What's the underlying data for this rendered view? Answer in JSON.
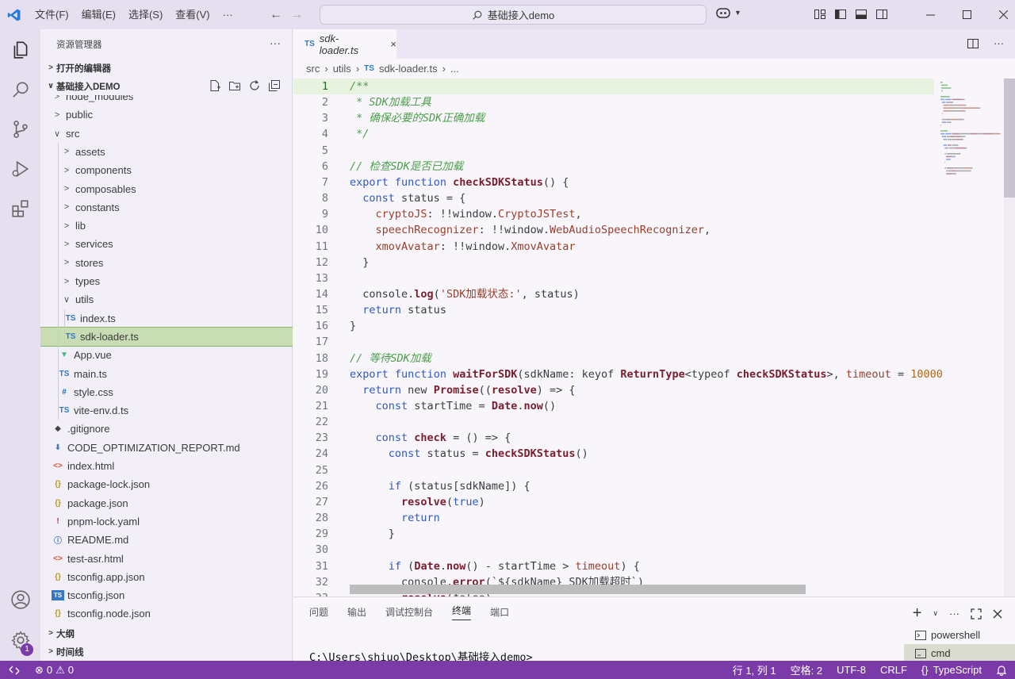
{
  "menu": [
    "文件(F)",
    "编辑(E)",
    "选择(S)",
    "查看(V)",
    "···"
  ],
  "search": "基础接入demo",
  "explorer": {
    "title": "资源管理器",
    "more": "···",
    "open_editors": "打开的编辑器",
    "project": "基础接入DEMO",
    "outline": "大纲",
    "timeline": "时间线"
  },
  "tree": [
    {
      "name": "node_modules",
      "type": "folder",
      "level": 1,
      "open": false
    },
    {
      "name": "public",
      "type": "folder",
      "level": 1,
      "open": false
    },
    {
      "name": "src",
      "type": "folder",
      "level": 1,
      "open": true
    },
    {
      "name": "assets",
      "type": "folder",
      "level": 2,
      "open": false
    },
    {
      "name": "components",
      "type": "folder",
      "level": 2,
      "open": false
    },
    {
      "name": "composables",
      "type": "folder",
      "level": 2,
      "open": false
    },
    {
      "name": "constants",
      "type": "folder",
      "level": 2,
      "open": false
    },
    {
      "name": "lib",
      "type": "folder",
      "level": 2,
      "open": false
    },
    {
      "name": "services",
      "type": "folder",
      "level": 2,
      "open": false
    },
    {
      "name": "stores",
      "type": "folder",
      "level": 2,
      "open": false
    },
    {
      "name": "types",
      "type": "folder",
      "level": 2,
      "open": false
    },
    {
      "name": "utils",
      "type": "folder",
      "level": 2,
      "open": true
    },
    {
      "name": "index.ts",
      "type": "ts",
      "level": 3
    },
    {
      "name": "sdk-loader.ts",
      "type": "ts",
      "level": 3,
      "selected": true
    },
    {
      "name": "App.vue",
      "type": "vue",
      "level": 2
    },
    {
      "name": "main.ts",
      "type": "ts",
      "level": 2
    },
    {
      "name": "style.css",
      "type": "css",
      "level": 2
    },
    {
      "name": "vite-env.d.ts",
      "type": "ts",
      "level": 2
    },
    {
      "name": ".gitignore",
      "type": "git",
      "level": 1
    },
    {
      "name": "CODE_OPTIMIZATION_REPORT.md",
      "type": "mdd",
      "level": 1
    },
    {
      "name": "index.html",
      "type": "html",
      "level": 1
    },
    {
      "name": "package-lock.json",
      "type": "json",
      "level": 1
    },
    {
      "name": "package.json",
      "type": "json",
      "level": 1
    },
    {
      "name": "pnpm-lock.yaml",
      "type": "yaml",
      "level": 1
    },
    {
      "name": "README.md",
      "type": "info",
      "level": 1
    },
    {
      "name": "test-asr.html",
      "type": "html",
      "level": 1
    },
    {
      "name": "tsconfig.app.json",
      "type": "json",
      "level": 1
    },
    {
      "name": "tsconfig.json",
      "type": "tsjson",
      "level": 1
    },
    {
      "name": "tsconfig.node.json",
      "type": "json",
      "level": 1
    }
  ],
  "tab": {
    "label": "sdk-loader.ts",
    "lang": "TS",
    "close": "×"
  },
  "breadcrumb": {
    "src": "src",
    "utils": "utils",
    "file": "sdk-loader.ts",
    "more": "..."
  },
  "code_lines": [
    [
      [
        "cmt",
        "/**"
      ]
    ],
    [
      [
        "cmt",
        " * SDK加载工具"
      ]
    ],
    [
      [
        "cmt",
        " * 确保必要的SDK正确加载"
      ]
    ],
    [
      [
        "cmt",
        " */"
      ]
    ],
    [],
    [
      [
        "cmt",
        "// 检查SDK是否已加载"
      ]
    ],
    [
      [
        "kw",
        "export"
      ],
      [
        "p",
        " "
      ],
      [
        "kw",
        "function"
      ],
      [
        "p",
        " "
      ],
      [
        "fn",
        "checkSDKStatus"
      ],
      [
        "p",
        "() {"
      ]
    ],
    [
      [
        "p",
        "  "
      ],
      [
        "kw",
        "const"
      ],
      [
        "p",
        " status = {"
      ]
    ],
    [
      [
        "p",
        "    "
      ],
      [
        "prop",
        "cryptoJS"
      ],
      [
        "p",
        ": !!window."
      ],
      [
        "prop",
        "CryptoJSTest"
      ],
      [
        "p",
        ","
      ]
    ],
    [
      [
        "p",
        "    "
      ],
      [
        "prop",
        "speechRecognizer"
      ],
      [
        "p",
        ": !!window."
      ],
      [
        "prop",
        "WebAudioSpeechRecognizer"
      ],
      [
        "p",
        ","
      ]
    ],
    [
      [
        "p",
        "    "
      ],
      [
        "prop",
        "xmovAvatar"
      ],
      [
        "p",
        ": !!window."
      ],
      [
        "prop",
        "XmovAvatar"
      ]
    ],
    [
      [
        "p",
        "  }"
      ]
    ],
    [],
    [
      [
        "p",
        "  console."
      ],
      [
        "fn",
        "log"
      ],
      [
        "p",
        "("
      ],
      [
        "str",
        "'SDK加载状态:'"
      ],
      [
        "p",
        ", status)"
      ]
    ],
    [
      [
        "p",
        "  "
      ],
      [
        "kw",
        "return"
      ],
      [
        "p",
        " status"
      ]
    ],
    [
      [
        "p",
        "}"
      ]
    ],
    [],
    [
      [
        "cmt",
        "// 等待SDK加载"
      ]
    ],
    [
      [
        "kw",
        "export"
      ],
      [
        "p",
        " "
      ],
      [
        "kw",
        "function"
      ],
      [
        "p",
        " "
      ],
      [
        "fn",
        "waitForSDK"
      ],
      [
        "p",
        "(sdkName: keyof "
      ],
      [
        "typ",
        "ReturnType"
      ],
      [
        "p",
        "<typeof "
      ],
      [
        "fn",
        "checkSDKStatus"
      ],
      [
        "p",
        ">, "
      ],
      [
        "prop",
        "timeout"
      ],
      [
        "p",
        " = "
      ],
      [
        "num",
        "10000"
      ]
    ],
    [
      [
        "p",
        "  "
      ],
      [
        "kw",
        "return"
      ],
      [
        "p",
        " new "
      ],
      [
        "typ",
        "Promise"
      ],
      [
        "p",
        "(("
      ],
      [
        "fn",
        "resolve"
      ],
      [
        "p",
        ") => {"
      ]
    ],
    [
      [
        "p",
        "    "
      ],
      [
        "kw",
        "const"
      ],
      [
        "p",
        " startTime = "
      ],
      [
        "typ",
        "Date"
      ],
      [
        "p",
        "."
      ],
      [
        "fn",
        "now"
      ],
      [
        "p",
        "()"
      ]
    ],
    [],
    [
      [
        "p",
        "    "
      ],
      [
        "kw",
        "const"
      ],
      [
        "p",
        " "
      ],
      [
        "fn",
        "check"
      ],
      [
        "p",
        " = () => {"
      ]
    ],
    [
      [
        "p",
        "      "
      ],
      [
        "kw",
        "const"
      ],
      [
        "p",
        " status = "
      ],
      [
        "fn",
        "checkSDKStatus"
      ],
      [
        "p",
        "()"
      ]
    ],
    [],
    [
      [
        "p",
        "      "
      ],
      [
        "kw",
        "if"
      ],
      [
        "p",
        " (status[sdkName]) {"
      ]
    ],
    [
      [
        "p",
        "        "
      ],
      [
        "fn",
        "resolve"
      ],
      [
        "p",
        "("
      ],
      [
        "kw",
        "true"
      ],
      [
        "p",
        ")"
      ]
    ],
    [
      [
        "p",
        "        "
      ],
      [
        "kw",
        "return"
      ]
    ],
    [
      [
        "p",
        "      }"
      ]
    ],
    [],
    [
      [
        "p",
        "      "
      ],
      [
        "kw",
        "if"
      ],
      [
        "p",
        " ("
      ],
      [
        "typ",
        "Date"
      ],
      [
        "p",
        "."
      ],
      [
        "fn",
        "now"
      ],
      [
        "p",
        "() - startTime > "
      ],
      [
        "prop",
        "timeout"
      ],
      [
        "p",
        ") {"
      ]
    ],
    [
      [
        "p",
        "        console."
      ],
      [
        "fn",
        "error"
      ],
      [
        "p",
        "(`${sdkName} SDK加载超时`)"
      ]
    ],
    [
      [
        "p",
        "        "
      ],
      [
        "fn",
        "resolve"
      ],
      [
        "p",
        "(false)"
      ]
    ]
  ],
  "panel": {
    "tabs": [
      "问题",
      "输出",
      "调试控制台",
      "终端",
      "端口"
    ],
    "active": "终端",
    "add": "+",
    "more": "···",
    "prompt": "C:\\Users\\shiuo\\Desktop\\基础接入demo>",
    "terminals": [
      "powershell",
      "cmd"
    ]
  },
  "status": {
    "errors": "0",
    "warnings": "0",
    "position": "行 1, 列 1",
    "spaces": "空格: 2",
    "encoding": "UTF-8",
    "eol": "CRLF",
    "language": "TypeScript",
    "language_icon": "{}"
  },
  "activity_badge": "1",
  "colors": {
    "accent": "#7a3aa8",
    "selection": "#c9ddb4"
  }
}
